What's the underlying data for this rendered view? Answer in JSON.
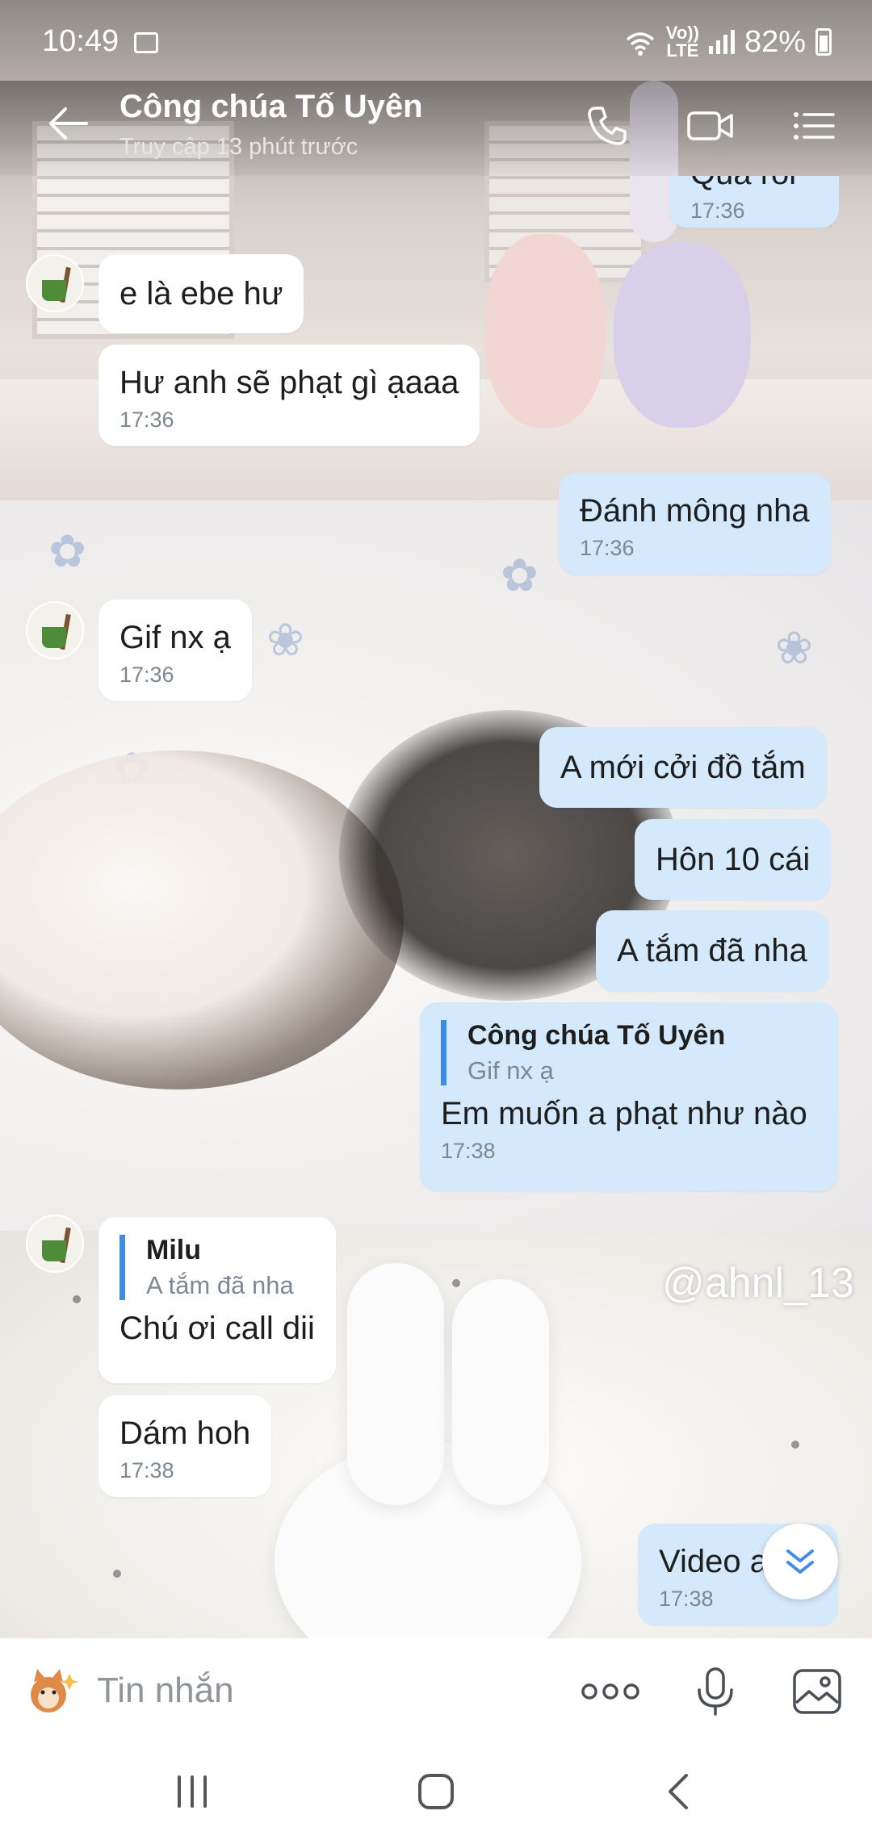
{
  "status_bar": {
    "time": "10:49",
    "network_label_top": "Vo))",
    "network_label_bottom": "LTE",
    "battery": "82%"
  },
  "header": {
    "title": "Công chúa Tố Uyên",
    "subtitle": "Truy cập 13 phút trước"
  },
  "messages": [
    {
      "id": "m0",
      "direction": "out",
      "text": "Quá rồi",
      "time": "17:36"
    },
    {
      "id": "m1",
      "direction": "in",
      "text": "e là ebe hư"
    },
    {
      "id": "m2",
      "direction": "in",
      "text": "Hư anh sẽ phạt gì ạaaa",
      "time": "17:36"
    },
    {
      "id": "m3",
      "direction": "out",
      "text": "Đánh mông nha",
      "time": "17:36"
    },
    {
      "id": "m4",
      "direction": "in",
      "text": "Gif nx ạ",
      "time": "17:36"
    },
    {
      "id": "m5",
      "direction": "out",
      "text": "A mới cởi đồ tắm"
    },
    {
      "id": "m6",
      "direction": "out",
      "text": "Hôn 10 cái"
    },
    {
      "id": "m7",
      "direction": "out",
      "text": "A tắm đã nha"
    },
    {
      "id": "m8",
      "direction": "out",
      "quote_name": "Công chúa Tố Uyên",
      "quote_text": "Gif nx ạ",
      "text": "Em muốn a phạt như nào",
      "time": "17:38"
    },
    {
      "id": "m9",
      "direction": "in",
      "quote_name": "Milu",
      "quote_text": "A tắm đã nha",
      "text": "Chú ơi call dii"
    },
    {
      "id": "m10",
      "direction": "in",
      "text": "Dám hoh",
      "time": "17:38"
    },
    {
      "id": "m11",
      "direction": "out",
      "text": "Video a",
      "time": "17:38"
    }
  ],
  "watermark": "@ahnl_13",
  "input": {
    "placeholder": "Tin nhắn"
  },
  "icons": {
    "back": "arrow-left-icon",
    "call": "phone-icon",
    "video": "video-camera-icon",
    "menu": "list-menu-icon",
    "more": "more-dots-icon",
    "mic": "microphone-icon",
    "gallery": "image-icon",
    "scroll": "double-chevron-down-icon"
  },
  "colors": {
    "outgoing_bubble": "#d4e9fb",
    "incoming_bubble": "#ffffff",
    "quote_bar": "#3e8be8",
    "timestamp": "#7c8893"
  }
}
